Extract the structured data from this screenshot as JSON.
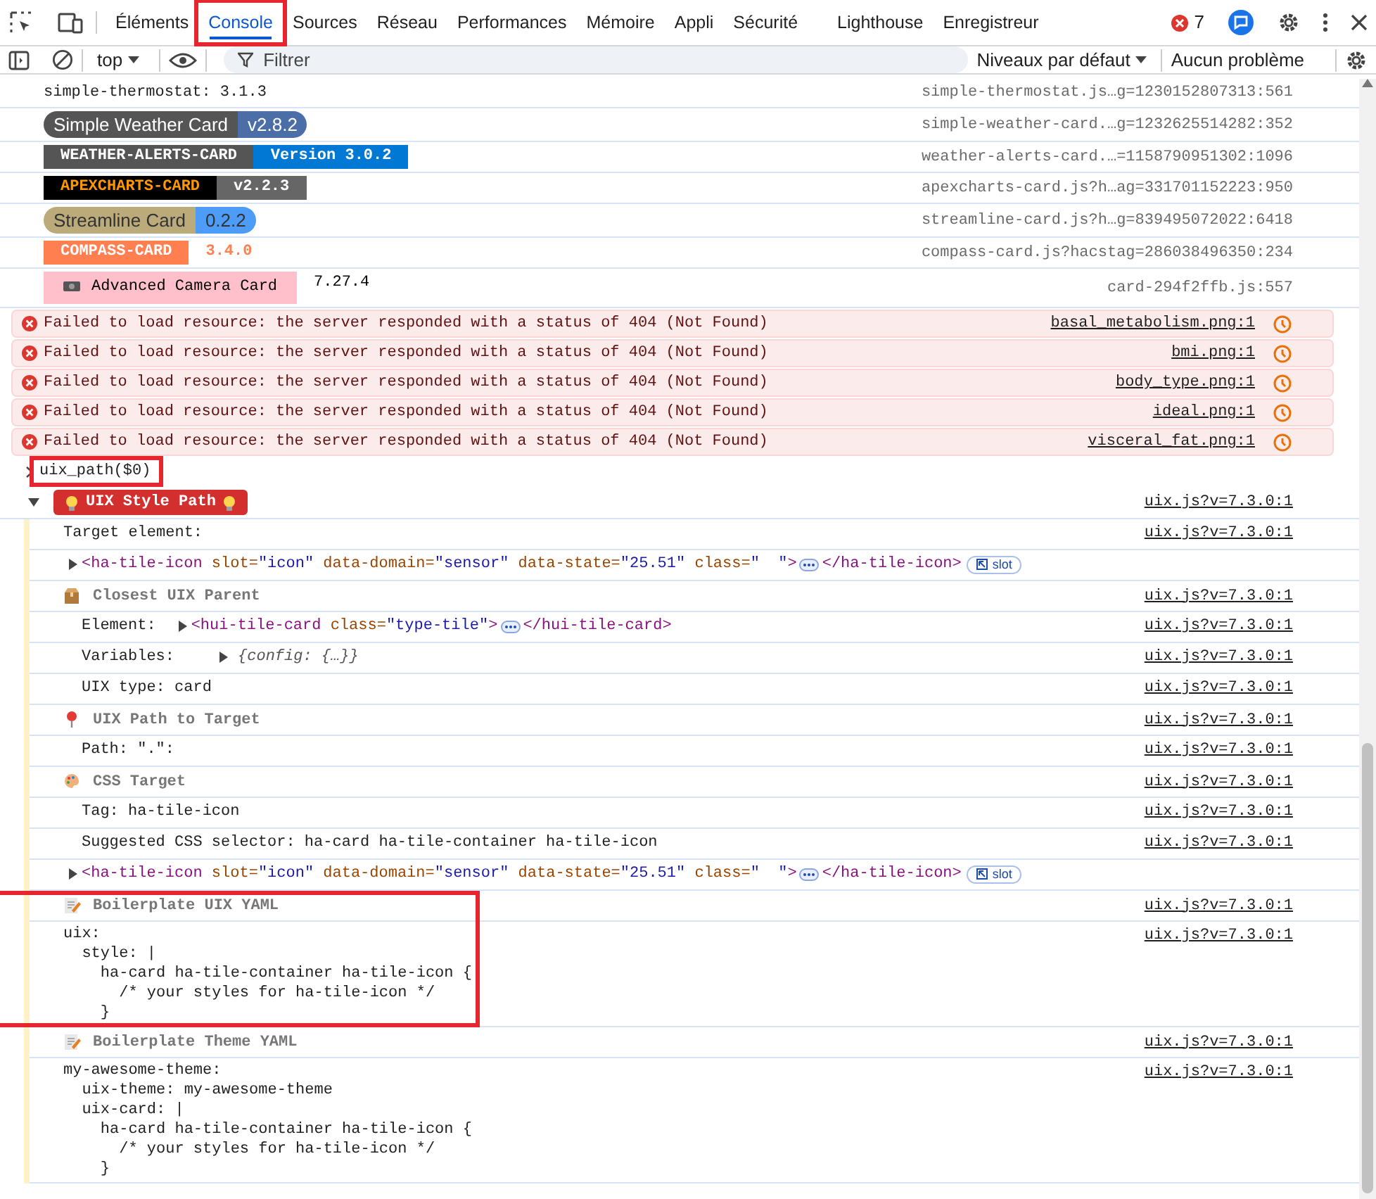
{
  "tabs": [
    {
      "label": "Éléments",
      "selected": false,
      "highlighted": false
    },
    {
      "label": "Console",
      "selected": true,
      "highlighted": true
    },
    {
      "label": "Sources",
      "selected": false,
      "highlighted": false
    },
    {
      "label": "Réseau",
      "selected": false,
      "highlighted": false
    },
    {
      "label": "Performances",
      "selected": false,
      "highlighted": false
    },
    {
      "label": "Mémoire",
      "selected": false,
      "highlighted": false
    },
    {
      "label": "Appli",
      "selected": false,
      "highlighted": false
    },
    {
      "label": "Sécurité",
      "selected": false,
      "highlighted": false
    },
    {
      "label": "Lighthouse",
      "selected": false,
      "highlighted": false
    },
    {
      "label": "Enregistreur",
      "selected": false,
      "highlighted": false
    }
  ],
  "error_count": "7",
  "toolbar": {
    "context": "top",
    "filter_placeholder": "Filtrer",
    "levels": "Niveaux par défaut",
    "issues": "Aucun problème"
  },
  "log": [
    {
      "kind": "text",
      "text": "simple-thermostat: 3.1.3",
      "source": "simple-thermostat.js…g=1230152807313:561"
    },
    {
      "kind": "pill_badge",
      "source": "simple-weather-card.…g=1232625514282:352",
      "parts": [
        {
          "text": "Simple Weather Card",
          "color": "#555555",
          "ink": {
            "color": "#ffffff"
          },
          "bold": false
        },
        {
          "text": "v2.8.2",
          "color": "#4c6ea7",
          "ink": {
            "color": "#ffffff"
          },
          "bold": false
        }
      ]
    },
    {
      "kind": "flat_badge",
      "source": "weather-alerts-card.…=1158790951302:1096",
      "parts": [
        {
          "text": "WEATHER-ALERTS-CARD",
          "color": "#555555",
          "ink": {
            "color": "#ffffff"
          },
          "bold": true
        },
        {
          "text": "Version 3.0.2",
          "color": "#0078d4",
          "ink": {
            "color": "#ffffff"
          },
          "bold": true
        }
      ]
    },
    {
      "kind": "flat_badge",
      "source": "apexcharts-card.js?h…ag=331701152223:950",
      "parts": [
        {
          "text": "APEXCHARTS-CARD",
          "color": "#000000",
          "ink": {
            "color": "#ff9800"
          },
          "bold": true
        },
        {
          "text": "v2.2.3",
          "color": "#666666",
          "ink": {
            "color": "#ffffff"
          },
          "bold": true
        }
      ]
    },
    {
      "kind": "pill_badge",
      "source": "streamline-card.js?h…g=839495072022:6418",
      "parts": [
        {
          "text": "Streamline Card",
          "color": "#bcab7a",
          "ink": {
            "color": "#333333"
          },
          "bold": false
        },
        {
          "text": "0.2.2",
          "color": "#4d9cf8",
          "ink": {
            "color": "#333333"
          },
          "bold": false
        }
      ]
    },
    {
      "kind": "flat_badge",
      "source": "compass-card.js?hacstag=286038496350:234",
      "parts": [
        {
          "text": "COMPASS-CARD",
          "color": "#ff7f50",
          "ink": {
            "color": "#ffffff"
          },
          "bold": true
        },
        {
          "text": "3.4.0",
          "color": "#ffffff",
          "ink": {
            "color": "#ff7f50"
          },
          "bold": true
        }
      ]
    },
    {
      "kind": "flat_badge",
      "source": "card-294f2ffb.js:557",
      "parts": [
        {
          "text": "Advanced Camera Card",
          "color": "#ffc0cb",
          "ink": {
            "color": "#000000"
          },
          "bold": false,
          "camera": true
        },
        {
          "text": "7.27.4",
          "color": "#ffffff",
          "ink": {
            "color": "#000000"
          },
          "bold": false
        }
      ]
    },
    {
      "kind": "error",
      "text": "Failed to load resource: the server responded with a status of 404 (Not Found)",
      "source": "basal_metabolism.png:1"
    },
    {
      "kind": "error",
      "text": "Failed to load resource: the server responded with a status of 404 (Not Found)",
      "source": "bmi.png:1"
    },
    {
      "kind": "error",
      "text": "Failed to load resource: the server responded with a status of 404 (Not Found)",
      "source": "body_type.png:1"
    },
    {
      "kind": "error",
      "text": "Failed to load resource: the server responded with a status of 404 (Not Found)",
      "source": "ideal.png:1"
    },
    {
      "kind": "error",
      "text": "Failed to load resource: the server responded with a status of 404 (Not Found)",
      "source": "visceral_fat.png:1"
    },
    {
      "kind": "input",
      "text": "uix_path($0)",
      "highlighted": true
    },
    {
      "kind": "group",
      "label": "UIX Style Path",
      "expanded": true,
      "source": "uix.js?v=7.3.0:1",
      "children": [
        {
          "kind": "text",
          "text": "Target element:",
          "source": "uix.js?v=7.3.0:1"
        },
        {
          "kind": "element",
          "open": [
            {
              "t": "<ha-tile-icon",
              "kind": "tag"
            },
            {
              "t": " slot=",
              "kind": "attr"
            },
            {
              "t": "\"icon\"",
              "kind": "value"
            },
            {
              "t": " data-domain=",
              "kind": "attr"
            },
            {
              "t": "\"sensor\"",
              "kind": "value"
            },
            {
              "t": " data-state=",
              "kind": "attr"
            },
            {
              "t": "\"25.51\"",
              "kind": "value"
            },
            {
              "t": " class=",
              "kind": "attr"
            },
            {
              "t": "\"  \"",
              "kind": "value"
            },
            {
              "t": ">",
              "kind": "tag"
            }
          ],
          "close": [
            {
              "t": "</ha-tile-icon>",
              "kind": "tag"
            }
          ],
          "reveal": "slot"
        },
        {
          "kind": "section",
          "title": "Closest UIX Parent",
          "source": "uix.js?v=7.3.0:1",
          "highlighted": false,
          "children": [
            {
              "kind": "field",
              "label": "Element:",
              "source": "uix.js?v=7.3.0:1",
              "element": {
                "open": [
                  {
                    "t": "<hui-tile-card",
                    "kind": "tag"
                  },
                  {
                    "t": " class=",
                    "kind": "attr"
                  },
                  {
                    "t": "\"type-tile\"",
                    "kind": "value"
                  },
                  {
                    "t": ">",
                    "kind": "tag"
                  }
                ],
                "close": [
                  {
                    "t": "</hui-tile-card>",
                    "kind": "tag"
                  }
                ]
              }
            },
            {
              "kind": "field",
              "label": "Variables:",
              "source": "uix.js?v=7.3.0:1",
              "object": "{config: {…}}"
            },
            {
              "kind": "text",
              "text": "UIX type: card",
              "source": "uix.js?v=7.3.0:1"
            }
          ]
        },
        {
          "kind": "section",
          "title": "UIX Path to Target",
          "source": "uix.js?v=7.3.0:1",
          "highlighted": false,
          "children": [
            {
              "kind": "text",
              "text": "Path: \".\":",
              "source": "uix.js?v=7.3.0:1"
            }
          ]
        },
        {
          "kind": "section",
          "title": "CSS Target",
          "source": "uix.js?v=7.3.0:1",
          "highlighted": false,
          "children": [
            {
              "kind": "text",
              "text": "Tag: ha-tile-icon",
              "source": "uix.js?v=7.3.0:1"
            },
            {
              "kind": "text",
              "text": "Suggested CSS selector: ha-card ha-tile-container ha-tile-icon",
              "source": "uix.js?v=7.3.0:1"
            },
            {
              "kind": "element",
              "open": [
                {
                  "t": "<ha-tile-icon",
                  "kind": "tag"
                },
                {
                  "t": " slot=",
                  "kind": "attr"
                },
                {
                  "t": "\"icon\"",
                  "kind": "value"
                },
                {
                  "t": " data-domain=",
                  "kind": "attr"
                },
                {
                  "t": "\"sensor\"",
                  "kind": "value"
                },
                {
                  "t": " data-state=",
                  "kind": "attr"
                },
                {
                  "t": "\"25.51\"",
                  "kind": "value"
                },
                {
                  "t": " class=",
                  "kind": "attr"
                },
                {
                  "t": "\"  \"",
                  "kind": "value"
                },
                {
                  "t": ">",
                  "kind": "tag"
                }
              ],
              "close": [
                {
                  "t": "</ha-tile-icon>",
                  "kind": "tag"
                }
              ],
              "reveal": "slot"
            }
          ]
        },
        {
          "kind": "section",
          "title": "Boilerplate UIX YAML",
          "source": "uix.js?v=7.3.0:1",
          "highlighted": true,
          "children": [
            {
              "kind": "code",
              "source": "uix.js?v=7.3.0:1",
              "lines": [
                "uix:",
                "  style: |",
                "    ha-card ha-tile-container ha-tile-icon {",
                "      /* your styles for ha-tile-icon */",
                "    }"
              ]
            }
          ]
        },
        {
          "kind": "section",
          "title": "Boilerplate Theme YAML",
          "source": "uix.js?v=7.3.0:1",
          "highlighted": false,
          "children": [
            {
              "kind": "code",
              "source": "uix.js?v=7.3.0:1",
              "lines": [
                "my-awesome-theme:",
                "  uix-theme: my-awesome-theme",
                "  uix-card: |",
                "    ha-card ha-tile-container ha-tile-icon {",
                "      /* your styles for ha-tile-icon */",
                "    }"
              ]
            }
          ]
        }
      ]
    }
  ]
}
